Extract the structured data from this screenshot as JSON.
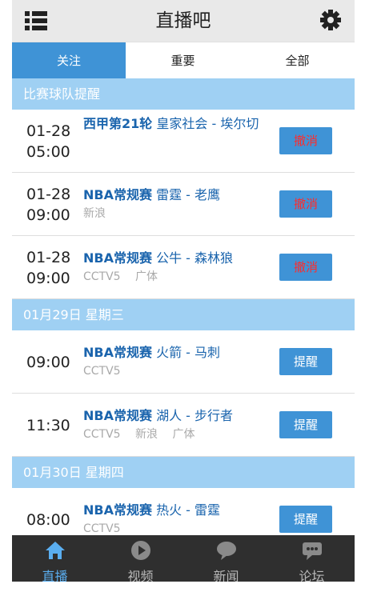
{
  "app": {
    "title": "直播吧"
  },
  "tabs": [
    {
      "label": "关注",
      "active": true
    },
    {
      "label": "重要",
      "active": false
    },
    {
      "label": "全部",
      "active": false
    }
  ],
  "sections": [
    {
      "header": "比赛球队提醒",
      "items": [
        {
          "date": "01-28",
          "time": "05:00",
          "league": "西甲第21轮",
          "teams": "皇家社会 - 埃尔切",
          "channels": [],
          "action": "撤消"
        },
        {
          "date": "01-28",
          "time": "09:00",
          "league": "NBA常规赛",
          "teams": "雷霆 - 老鹰",
          "channels": [
            "新浪"
          ],
          "action": "撤消"
        },
        {
          "date": "01-28",
          "time": "09:00",
          "league": "NBA常规赛",
          "teams": "公牛 - 森林狼",
          "channels": [
            "CCTV5",
            "广体"
          ],
          "action": "撤消"
        }
      ]
    },
    {
      "header": "01月29日 星期三",
      "items": [
        {
          "time": "09:00",
          "league": "NBA常规赛",
          "teams": "火箭 - 马刺",
          "channels": [
            "CCTV5"
          ],
          "action": "提醒"
        },
        {
          "time": "11:30",
          "league": "NBA常规赛",
          "teams": "湖人 - 步行者",
          "channels": [
            "CCTV5",
            "新浪",
            "广体"
          ],
          "action": "提醒"
        }
      ]
    },
    {
      "header": "01月30日 星期四",
      "items": [
        {
          "time": "08:00",
          "league": "NBA常规赛",
          "teams": "热火 - 雷霆",
          "channels": [
            "CCTV5"
          ],
          "action": "提醒"
        }
      ]
    }
  ],
  "bottom_nav": [
    {
      "label": "直播",
      "icon": "home-icon",
      "active": true
    },
    {
      "label": "视频",
      "icon": "play-icon",
      "active": false
    },
    {
      "label": "新闻",
      "icon": "news-bubble-icon",
      "active": false
    },
    {
      "label": "论坛",
      "icon": "forum-chat-icon",
      "active": false
    }
  ],
  "colors": {
    "accent": "#3f93d6",
    "section_bg": "#9fd0f3",
    "match_text": "#1a64ad",
    "cancel_text": "#ff2b2b",
    "nav_bg": "#2f2f2f",
    "nav_active": "#5aaef0"
  }
}
